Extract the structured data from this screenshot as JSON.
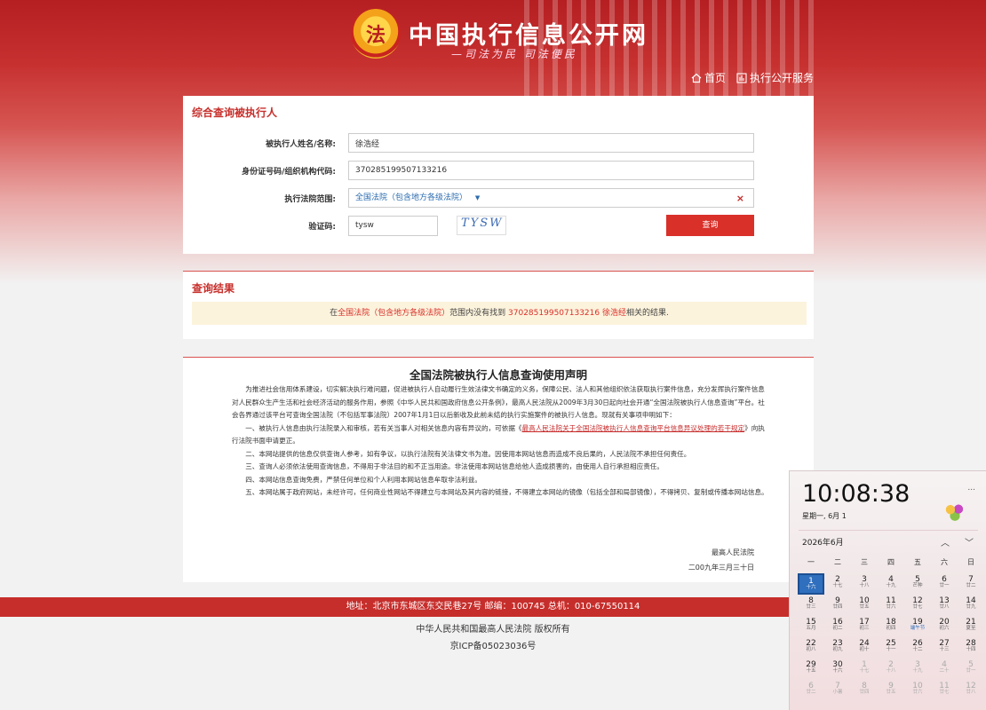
{
  "header": {
    "title": "中国执行信息公开网",
    "slogan": "—司法为民  司法便民",
    "logo_char": "法",
    "nav": [
      {
        "icon": "home-icon",
        "label": "首页"
      },
      {
        "icon": "chart-icon",
        "label": "执行公开服务"
      }
    ]
  },
  "query": {
    "section_title": "综合查询被执行人",
    "name_label": "被执行人姓名/名称:",
    "name_value": "徐浩经",
    "id_label": "身份证号码/组织机构代码:",
    "id_value": "370285199507133216",
    "court_label": "执行法院范围:",
    "court_value": "全国法院（包含地方各级法院）",
    "court_clear": "×",
    "captcha_label": "验证码:",
    "captcha_value": "tysw",
    "captcha_image_text": "TYSW",
    "submit_label": "查询"
  },
  "result": {
    "section_title": "查询结果",
    "p1": "在",
    "scope": "全国法院（包含地方各级法院）",
    "p2": "范围内没有找到 ",
    "id": "370285199507133216",
    "sp": " ",
    "name": "徐浩经",
    "p3": "相关的结果."
  },
  "declaration": {
    "title": "全国法院被执行人信息查询使用声明",
    "para1": "为推进社会信用体系建设，切实解决执行难问题，促进被执行人自动履行生效法律文书确定的义务，保障公民、法人和其他组织依法获取执行案件信息，充分发挥执行案件信息对人民群众生产生活和社会经济活动的服务作用，参照《中华人民共和国政府信息公开条例》，最高人民法院从2009年3月30日起向社会开通“全国法院被执行人信息查询”平台。社会各界通过该平台可查询全国法院（不包括军事法院）2007年1月1日以后新收及此前未结的执行实施案件的被执行人信息。现就有关事项申明如下：",
    "para2_a": "一、被执行人信息由执行法院录入和审核，若有关当事人对相关信息内容有异议的，可依据《",
    "para2_link": "最高人民法院关于全国法院被执行人信息查询平台信息异议处理的若干规定",
    "para2_b": "》向执行法院书面申请更正。",
    "para3": "二、本网站提供的信息仅供查询人参考，如有争议，以执行法院有关法律文书为准。因使用本网站信息而造成不良后果的，人民法院不承担任何责任。",
    "para4": "三、查询人必须依法使用查询信息，不得用于非法目的和不正当用途。非法使用本网站信息给他人造成损害的，由使用人自行承担相应责任。",
    "para5": "四、本网站信息查询免费，严禁任何单位和个人利用本网站信息牟取非法利益。",
    "para6": "五、本网站属于政府网站，未经许可，任何商业性网站不得建立与本网站及其内容的链接，不得建立本网站的镜像（包括全部和局部镜像），不得拷贝、复制或传播本网站信息。",
    "signature": "最高人民法院",
    "date": "二00九年三月三十日"
  },
  "footer": {
    "address": "地址：北京市东城区东交民巷27号   邮编：100745   总机：010-67550114",
    "copyright": "中华人民共和国最高人民法院 版权所有",
    "icp": "京ICP备05023036号"
  },
  "clock": {
    "time": "10:08:38",
    "date": "星期一, 6月 1",
    "month_title": "2026年6月",
    "up": "︿",
    "down": "﹀",
    "more": "...",
    "weekdays": [
      "一",
      "二",
      "三",
      "四",
      "五",
      "六",
      "日"
    ],
    "weeks": [
      [
        [
          "1",
          "十六",
          "today"
        ],
        [
          "2",
          "十七"
        ],
        [
          "3",
          "十八"
        ],
        [
          "4",
          "十九"
        ],
        [
          "5",
          "芒种"
        ],
        [
          "6",
          "廿一"
        ],
        [
          "7",
          "廿二"
        ]
      ],
      [
        [
          "8",
          "廿三"
        ],
        [
          "9",
          "廿四"
        ],
        [
          "10",
          "廿五"
        ],
        [
          "11",
          "廿六"
        ],
        [
          "12",
          "廿七"
        ],
        [
          "13",
          "廿八"
        ],
        [
          "14",
          "廿九"
        ]
      ],
      [
        [
          "15",
          "五月"
        ],
        [
          "16",
          "初二"
        ],
        [
          "17",
          "初三"
        ],
        [
          "18",
          "初四"
        ],
        [
          "19",
          "端午节",
          "fest"
        ],
        [
          "20",
          "初六"
        ],
        [
          "21",
          "夏至"
        ]
      ],
      [
        [
          "22",
          "初八"
        ],
        [
          "23",
          "初九"
        ],
        [
          "24",
          "初十"
        ],
        [
          "25",
          "十一"
        ],
        [
          "26",
          "十二"
        ],
        [
          "27",
          "十三"
        ],
        [
          "28",
          "十四"
        ]
      ],
      [
        [
          "29",
          "十五"
        ],
        [
          "30",
          "十六"
        ],
        [
          "1",
          "十七",
          "dim"
        ],
        [
          "2",
          "十八",
          "dim"
        ],
        [
          "3",
          "十九",
          "dim"
        ],
        [
          "4",
          "二十",
          "dim"
        ],
        [
          "5",
          "廿一",
          "dim"
        ]
      ],
      [
        [
          "6",
          "廿二",
          "dim"
        ],
        [
          "7",
          "小暑",
          "dim"
        ],
        [
          "8",
          "廿四",
          "dim"
        ],
        [
          "9",
          "廿五",
          "dim"
        ],
        [
          "10",
          "廿六",
          "dim"
        ],
        [
          "11",
          "廿七",
          "dim"
        ],
        [
          "12",
          "廿八",
          "dim"
        ]
      ]
    ]
  }
}
